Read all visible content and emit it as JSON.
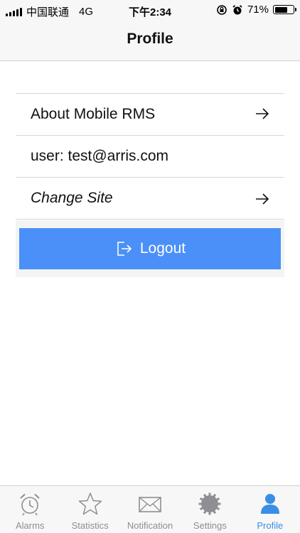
{
  "status_bar": {
    "carrier": "中国联通",
    "network": "4G",
    "time": "下午2:34",
    "battery_percent": "71%",
    "battery_level": 0.71
  },
  "nav": {
    "title": "Profile"
  },
  "menu": {
    "about": "About Mobile RMS",
    "user": "user: test@arris.com",
    "change_site": "Change Site"
  },
  "logout": {
    "label": "Logout"
  },
  "tabs": [
    {
      "label": "Alarms",
      "icon": "alarm-clock-icon"
    },
    {
      "label": "Statistics",
      "icon": "star-icon"
    },
    {
      "label": "Notification",
      "icon": "envelope-icon"
    },
    {
      "label": "Settings",
      "icon": "gear-icon"
    },
    {
      "label": "Profile",
      "icon": "person-icon",
      "active": true
    }
  ],
  "colors": {
    "accent": "#4a90f8",
    "tab_active": "#3a8ee6",
    "tab_inactive": "#8e8e93"
  }
}
